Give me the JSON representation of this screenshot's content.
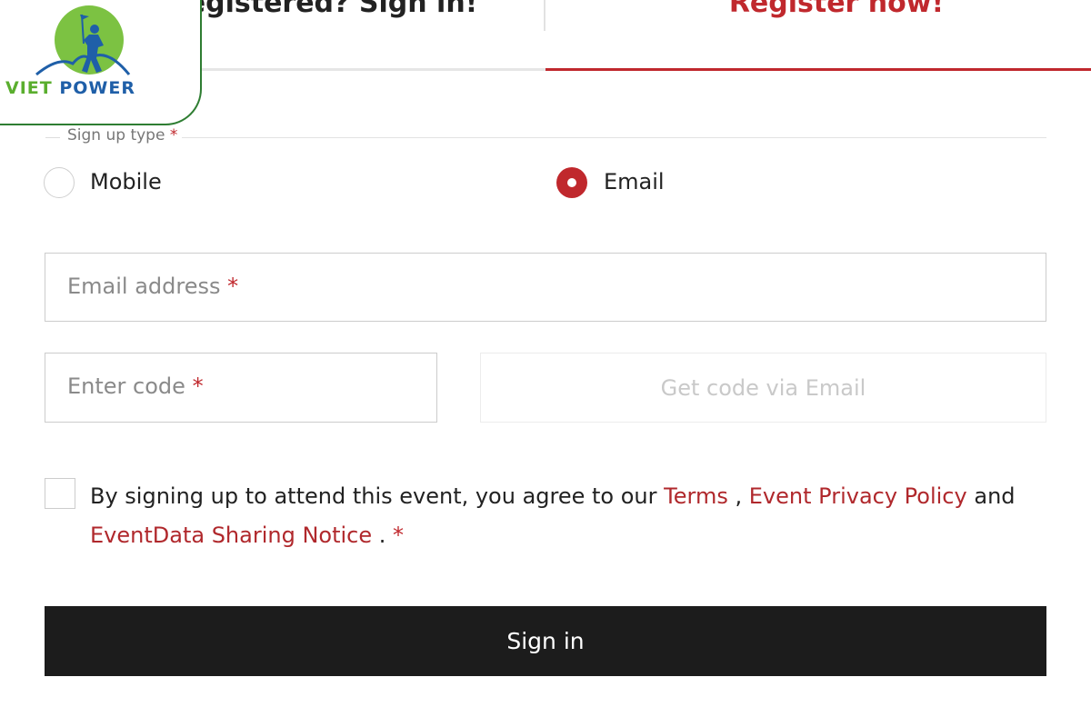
{
  "tabs": [
    {
      "label": "Already registered? Sign in!"
    },
    {
      "label": "Register now!"
    }
  ],
  "logo": {
    "word1": "VIET",
    "word2": "POWER"
  },
  "signup_type": {
    "legend": "Sign up type",
    "required_mark": "*",
    "options": [
      {
        "label": "Mobile",
        "selected": false
      },
      {
        "label": "Email",
        "selected": true
      }
    ]
  },
  "fields": {
    "email_placeholder": "Email address",
    "code_placeholder": "Enter code",
    "required_mark": "*"
  },
  "get_code_label": "Get code via Email",
  "agreement": {
    "text_before": "By signing up to attend this event, you agree to our",
    "terms": "Terms",
    "comma": ",",
    "privacy": "Event Privacy Policy",
    "and": "and",
    "sharing": "EventData Sharing Notice",
    "period": ".",
    "required_mark": "*",
    "checked": false
  },
  "submit_label": "Sign in",
  "colors": {
    "accent": "#c0282d",
    "button": "#1c1c1c",
    "logo_green": "#5aae2e",
    "logo_blue": "#1f5fa8"
  }
}
